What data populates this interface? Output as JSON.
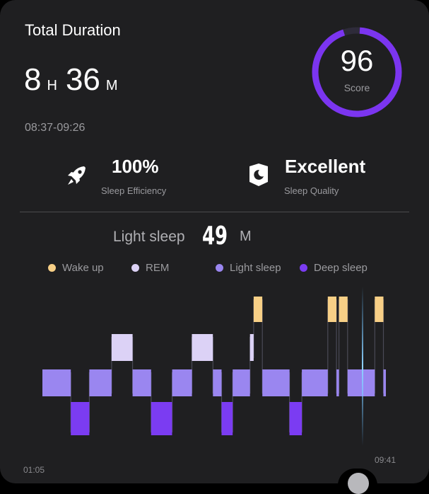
{
  "header": {
    "title": "Total Duration"
  },
  "duration": {
    "hours": "8",
    "hours_unit": "H",
    "minutes": "36",
    "minutes_unit": "M"
  },
  "time_range": "08:37-09:26",
  "score": {
    "value": "96",
    "label": "Score",
    "fraction": 0.96,
    "color": "#7b35f0"
  },
  "stats": [
    {
      "value": "100%",
      "label": "Sleep Efficiency",
      "icon": "rocket-icon"
    },
    {
      "value": "Excellent",
      "label": "Sleep Quality",
      "icon": "moon-shield-icon"
    }
  ],
  "selected_stage": {
    "label": "Light sleep",
    "value": "49",
    "unit": "M"
  },
  "legend": [
    {
      "label": "Wake up",
      "color": "#f7cf86"
    },
    {
      "label": "REM",
      "color": "#dcd2f6"
    },
    {
      "label": "Light sleep",
      "color": "#9a86f0"
    },
    {
      "label": "Deep sleep",
      "color": "#7b3cf2"
    }
  ],
  "timeline": {
    "start_label": "01:05",
    "end_label": "09:41",
    "stage_order": [
      "Wake up",
      "REM",
      "Light sleep",
      "Deep sleep"
    ],
    "segments": [
      {
        "stage": "Light sleep",
        "duration": 46
      },
      {
        "stage": "Deep sleep",
        "duration": 30
      },
      {
        "stage": "Light sleep",
        "duration": 36
      },
      {
        "stage": "REM",
        "duration": 34
      },
      {
        "stage": "Light sleep",
        "duration": 30
      },
      {
        "stage": "Deep sleep",
        "duration": 34
      },
      {
        "stage": "Light sleep",
        "duration": 32
      },
      {
        "stage": "REM",
        "duration": 34
      },
      {
        "stage": "Light sleep",
        "duration": 14
      },
      {
        "stage": "Deep sleep",
        "duration": 18
      },
      {
        "stage": "Light sleep",
        "duration": 28
      },
      {
        "stage": "REM",
        "duration": 6
      },
      {
        "stage": "Wake up",
        "duration": 14
      },
      {
        "stage": "Light sleep",
        "duration": 44
      },
      {
        "stage": "Deep sleep",
        "duration": 20
      },
      {
        "stage": "Light sleep",
        "duration": 42
      },
      {
        "stage": "Wake up",
        "duration": 14
      },
      {
        "stage": "Light sleep",
        "duration": 4
      },
      {
        "stage": "Wake up",
        "duration": 14
      },
      {
        "stage": "Light sleep",
        "duration": 44
      },
      {
        "stage": "Wake up",
        "duration": 14
      },
      {
        "stage": "Light sleep",
        "duration": 4
      }
    ],
    "cursor_fraction": 0.932
  }
}
